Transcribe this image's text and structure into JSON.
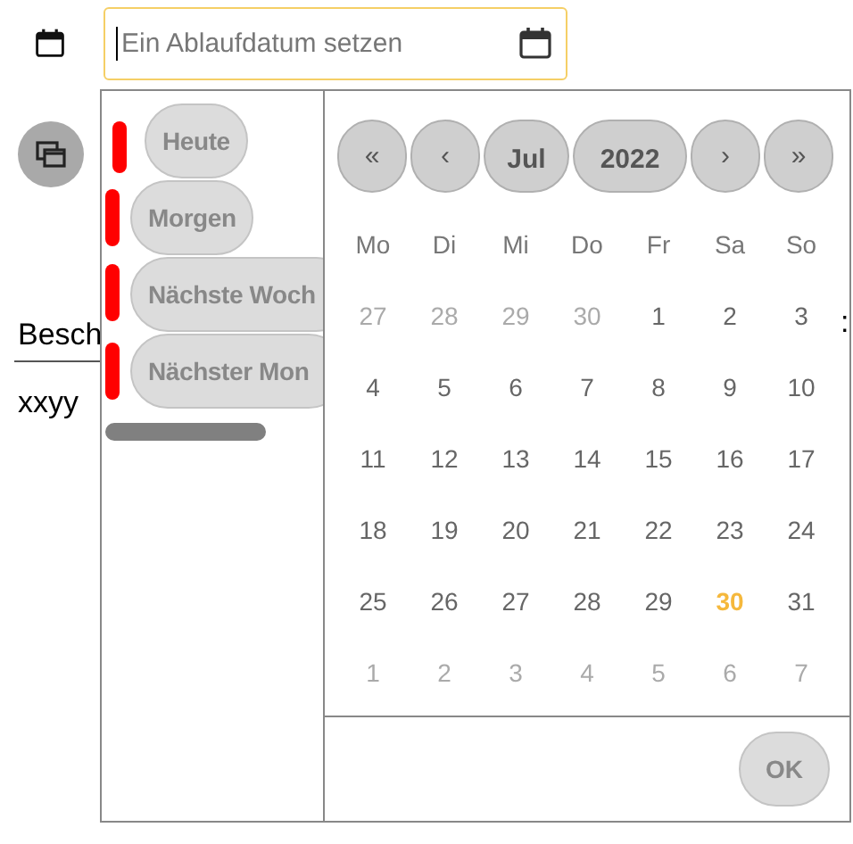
{
  "date_field": {
    "placeholder": "Ein Ablaufdatum setzen"
  },
  "background": {
    "label": "Besch",
    "label_tail": ":",
    "value": "xxyy"
  },
  "presets": [
    {
      "label": "Heute"
    },
    {
      "label": "Morgen"
    },
    {
      "label": "Nächste Woch"
    },
    {
      "label": "Nächster Mon"
    }
  ],
  "calendar": {
    "nav": [
      {
        "label": "«",
        "kind": "arrow"
      },
      {
        "label": "‹",
        "kind": "arrow"
      },
      {
        "label": "Jul",
        "kind": "month"
      },
      {
        "label": "2022",
        "kind": "year"
      },
      {
        "label": "›",
        "kind": "arrow"
      },
      {
        "label": "»",
        "kind": "arrow"
      }
    ],
    "weekdays": [
      "Mo",
      "Di",
      "Mi",
      "Do",
      "Fr",
      "Sa",
      "So"
    ],
    "weeks": [
      [
        {
          "label": "27",
          "outside": true,
          "selected": false
        },
        {
          "label": "28",
          "outside": true,
          "selected": false
        },
        {
          "label": "29",
          "outside": true,
          "selected": false
        },
        {
          "label": "30",
          "outside": true,
          "selected": false
        },
        {
          "label": "1",
          "outside": false,
          "selected": false
        },
        {
          "label": "2",
          "outside": false,
          "selected": false
        },
        {
          "label": "3",
          "outside": false,
          "selected": false
        }
      ],
      [
        {
          "label": "4",
          "outside": false,
          "selected": false
        },
        {
          "label": "5",
          "outside": false,
          "selected": false
        },
        {
          "label": "6",
          "outside": false,
          "selected": false
        },
        {
          "label": "7",
          "outside": false,
          "selected": false
        },
        {
          "label": "8",
          "outside": false,
          "selected": false
        },
        {
          "label": "9",
          "outside": false,
          "selected": false
        },
        {
          "label": "10",
          "outside": false,
          "selected": false
        }
      ],
      [
        {
          "label": "11",
          "outside": false,
          "selected": false
        },
        {
          "label": "12",
          "outside": false,
          "selected": false
        },
        {
          "label": "13",
          "outside": false,
          "selected": false
        },
        {
          "label": "14",
          "outside": false,
          "selected": false
        },
        {
          "label": "15",
          "outside": false,
          "selected": false
        },
        {
          "label": "16",
          "outside": false,
          "selected": false
        },
        {
          "label": "17",
          "outside": false,
          "selected": false
        }
      ],
      [
        {
          "label": "18",
          "outside": false,
          "selected": false
        },
        {
          "label": "19",
          "outside": false,
          "selected": false
        },
        {
          "label": "20",
          "outside": false,
          "selected": false
        },
        {
          "label": "21",
          "outside": false,
          "selected": false
        },
        {
          "label": "22",
          "outside": false,
          "selected": false
        },
        {
          "label": "23",
          "outside": false,
          "selected": false
        },
        {
          "label": "24",
          "outside": false,
          "selected": false
        }
      ],
      [
        {
          "label": "25",
          "outside": false,
          "selected": false
        },
        {
          "label": "26",
          "outside": false,
          "selected": false
        },
        {
          "label": "27",
          "outside": false,
          "selected": false
        },
        {
          "label": "28",
          "outside": false,
          "selected": false
        },
        {
          "label": "29",
          "outside": false,
          "selected": false
        },
        {
          "label": "30",
          "outside": false,
          "selected": true
        },
        {
          "label": "31",
          "outside": false,
          "selected": false
        }
      ],
      [
        {
          "label": "1",
          "outside": true,
          "selected": false
        },
        {
          "label": "2",
          "outside": true,
          "selected": false
        },
        {
          "label": "3",
          "outside": true,
          "selected": false
        },
        {
          "label": "4",
          "outside": true,
          "selected": false
        },
        {
          "label": "5",
          "outside": true,
          "selected": false
        },
        {
          "label": "6",
          "outside": true,
          "selected": false
        },
        {
          "label": "7",
          "outside": true,
          "selected": false
        }
      ]
    ],
    "ok_button": "OK"
  }
}
